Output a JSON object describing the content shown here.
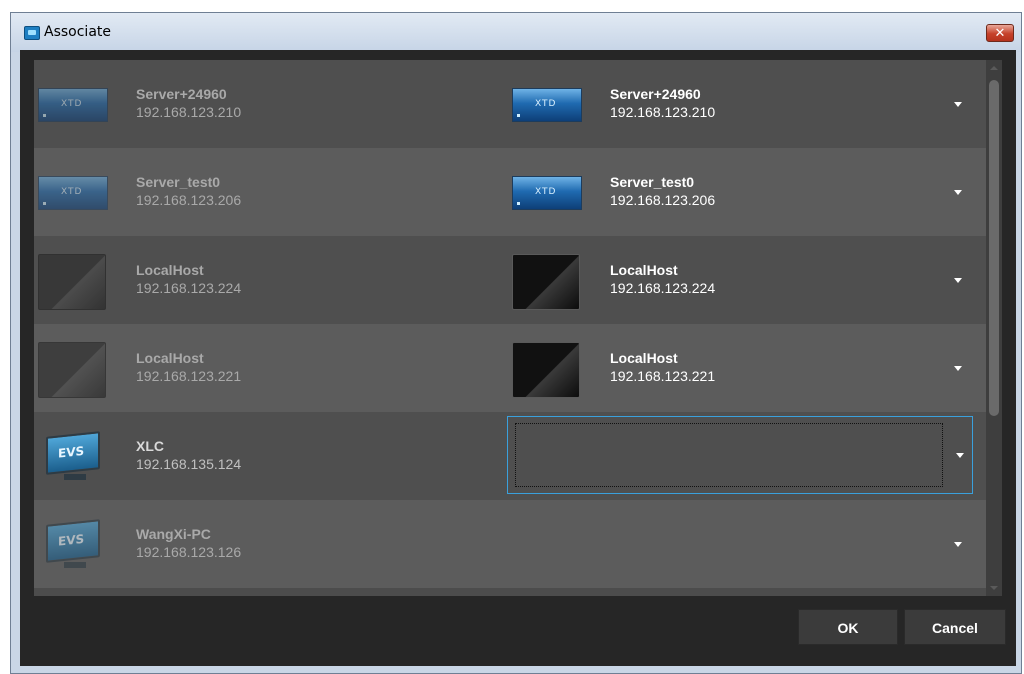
{
  "window": {
    "title": "Associate",
    "close_glyph": "✕"
  },
  "rows": [
    {
      "left": {
        "name": "Server+24960",
        "ip": "192.168.123.210",
        "icon": "xtd-server-icon"
      },
      "right": {
        "name": "Server+24960",
        "ip": "192.168.123.210",
        "icon": "xtd-server-icon"
      }
    },
    {
      "left": {
        "name": "Server_test0",
        "ip": "192.168.123.206",
        "icon": "xtd-server-icon"
      },
      "right": {
        "name": "Server_test0",
        "ip": "192.168.123.206",
        "icon": "xtd-server-icon"
      }
    },
    {
      "left": {
        "name": "LocalHost",
        "ip": "192.168.123.224",
        "icon": "monitor-icon"
      },
      "right": {
        "name": "LocalHost",
        "ip": "192.168.123.224",
        "icon": "monitor-icon"
      }
    },
    {
      "left": {
        "name": "LocalHost",
        "ip": "192.168.123.221",
        "icon": "monitor-icon"
      },
      "right": {
        "name": "LocalHost",
        "ip": "192.168.123.221",
        "icon": "monitor-icon"
      }
    },
    {
      "left": {
        "name": "XLC",
        "ip": "192.168.135.124",
        "icon": "evs-pc-icon",
        "evs_label": "EVS"
      },
      "right": {
        "name": "",
        "ip": "",
        "state": "focused-empty"
      }
    },
    {
      "left": {
        "name": "WangXi-PC",
        "ip": "192.168.123.126",
        "icon": "evs-pc-icon",
        "evs_label": "EVS"
      },
      "right": {
        "name": "",
        "ip": ""
      }
    }
  ],
  "xtd_label": "XTD",
  "buttons": {
    "ok": "OK",
    "cancel": "Cancel"
  },
  "colors": {
    "background": "#262626",
    "focus_border": "#3aa0dc",
    "text_active": "#ffffff",
    "text_dim": "#a9a9a9"
  }
}
